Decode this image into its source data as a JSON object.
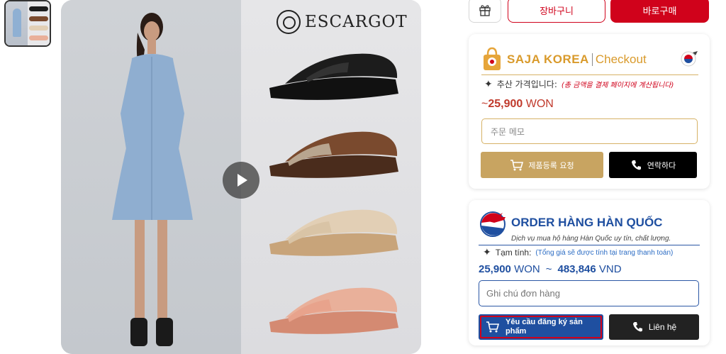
{
  "thumbnail": {
    "alt": "product-thumbnail"
  },
  "hero": {
    "brand": "ESCARGOT",
    "sandal_colors": [
      "#1c1c1c",
      "#7a4a2e",
      "#e2cfb5",
      "#e9b09a"
    ]
  },
  "actions": {
    "gift_icon": "gift-icon",
    "cart_label": "장바구니",
    "buy_label": "바로구매"
  },
  "saja": {
    "title": "SAJA KOREA",
    "checkout": "Checkout",
    "estimate_label": "추산 가격입니다:",
    "estimate_note": "(총 금액을 결제 페이지에 계산됩니다)",
    "price_prefix": "~",
    "price_value": "25,900",
    "price_unit": "WON",
    "memo_placeholder": "주문 메모",
    "register_label": "제품등록 요청",
    "contact_label": "연락하다",
    "accent": "#d99a2b"
  },
  "order_vn": {
    "title": "ORDER HÀNG HÀN QUỐC",
    "subtitle": "Dịch vụ mua hộ hàng Hàn Quốc uy tín, chất lượng.",
    "estimate_label": "Tạm tính:",
    "estimate_note": "(Tổng giá sẽ được tính tại trang thanh toán)",
    "price_won_value": "25,900",
    "price_won_unit": "WON",
    "price_sep": "~",
    "price_vnd_value": "483,846",
    "price_vnd_unit": "VND",
    "memo_placeholder": "Ghi chú đơn hàng",
    "register_label": "Yêu cầu đăng ký sản phẩm",
    "contact_label": "Liên hệ",
    "accent": "#1f4fa0"
  }
}
